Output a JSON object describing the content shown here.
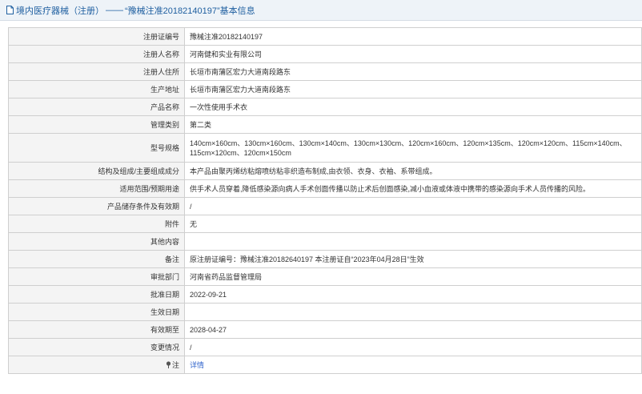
{
  "header": {
    "prefix": "境内医疗器械（注册）",
    "separator": "——",
    "title": "“豫械注准20182140197”基本信息"
  },
  "rows": [
    {
      "label": "注册证编号",
      "value": "豫械注准20182140197"
    },
    {
      "label": "注册人名称",
      "value": "河南健和实业有限公司"
    },
    {
      "label": "注册人住所",
      "value": "长垣市南蒲区宏力大道南段路东"
    },
    {
      "label": "生产地址",
      "value": "长垣市南蒲区宏力大道南段路东"
    },
    {
      "label": "产品名称",
      "value": "一次性使用手术衣"
    },
    {
      "label": "管理类别",
      "value": "第二类"
    },
    {
      "label": "型号规格",
      "value": "140cm×160cm、130cm×160cm、130cm×140cm、130cm×130cm、120cm×160cm、120cm×135cm、120cm×120cm、115cm×140cm、115cm×120cm、120cm×150cm"
    },
    {
      "label": "结构及组成/主要组成成分",
      "value": "本产品由聚丙烯纺粘熔喷纺粘非织造布制成,由衣领、衣身、衣袖、系带组成。"
    },
    {
      "label": "适用范围/预期用途",
      "value": "供手术人员穿着,降低感染源向病人手术创面传播以防止术后创面感染,减小血液或体液中携带的感染源向手术人员传播的风险。"
    },
    {
      "label": "产品储存条件及有效期",
      "value": "/"
    },
    {
      "label": "附件",
      "value": "无"
    },
    {
      "label": "其他内容",
      "value": ""
    },
    {
      "label": "备注",
      "value": "原注册证编号：豫械注准20182640197 本注册证自“2023年04月28日”生效"
    },
    {
      "label": "审批部门",
      "value": "河南省药品监督管理局"
    },
    {
      "label": "批准日期",
      "value": "2022-09-21"
    },
    {
      "label": "生效日期",
      "value": ""
    },
    {
      "label": "有效期至",
      "value": "2028-04-27"
    },
    {
      "label": "变更情况",
      "value": "/"
    }
  ],
  "note": {
    "label": "注",
    "link_text": "详情",
    "icon": "pin-icon"
  },
  "colors": {
    "header_text": "#1f5fa0",
    "header_bg": "#eef3f8",
    "label_bg": "#f4f4f4",
    "border": "#cfcfcf",
    "link": "#3366cc"
  }
}
